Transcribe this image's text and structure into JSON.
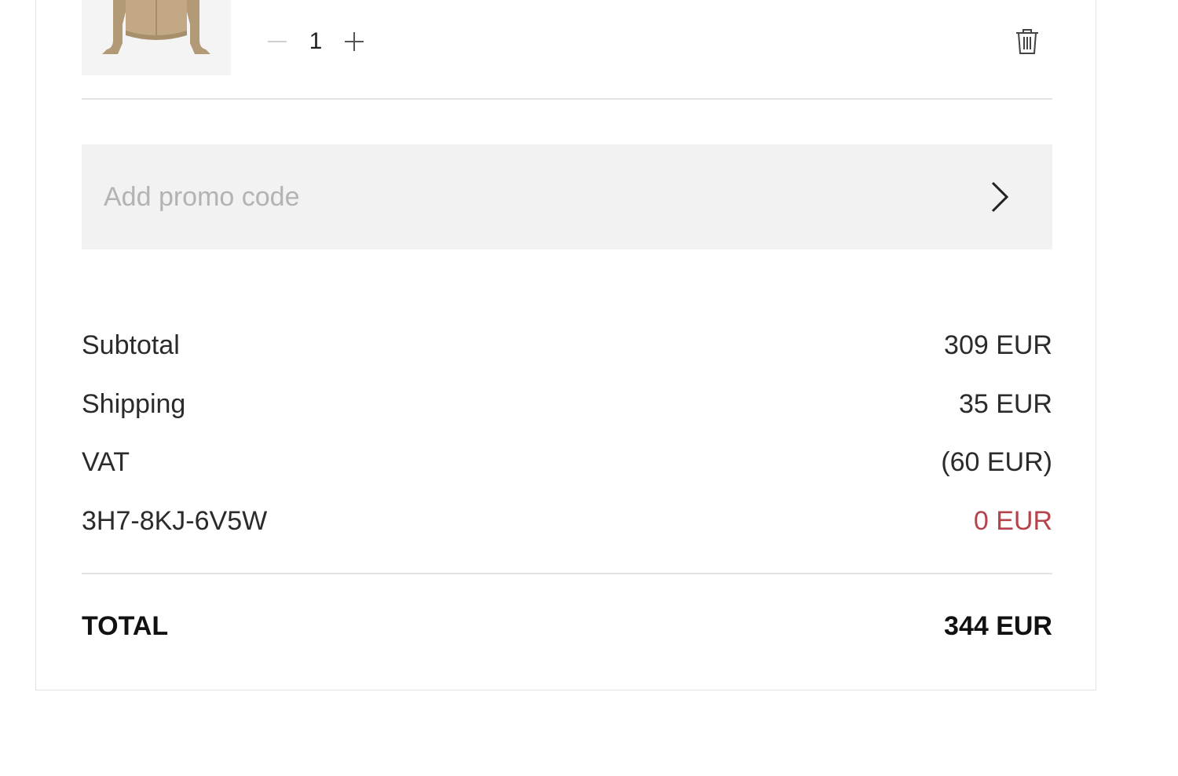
{
  "cart_item": {
    "image_alt": "beige knit cardigan",
    "quantity": "1",
    "decrement_icon": "minus-icon",
    "increment_icon": "plus-icon",
    "remove_icon": "trash-icon"
  },
  "promo": {
    "placeholder": "Add promo code",
    "submit_icon": "chevron-right-icon"
  },
  "summary": {
    "rows": [
      {
        "label": "Subtotal",
        "value": "309 EUR"
      },
      {
        "label": "Shipping",
        "value": "35 EUR"
      },
      {
        "label": "VAT",
        "value": "(60 EUR)"
      },
      {
        "label": "3H7-8KJ-6V5W",
        "value": "0 EUR"
      }
    ],
    "total_label": "TOTAL",
    "total_value": "344 EUR"
  },
  "colors": {
    "discount": "#b5434c",
    "promo_background": "#f2f2f2",
    "divider": "#e4e4e4"
  }
}
